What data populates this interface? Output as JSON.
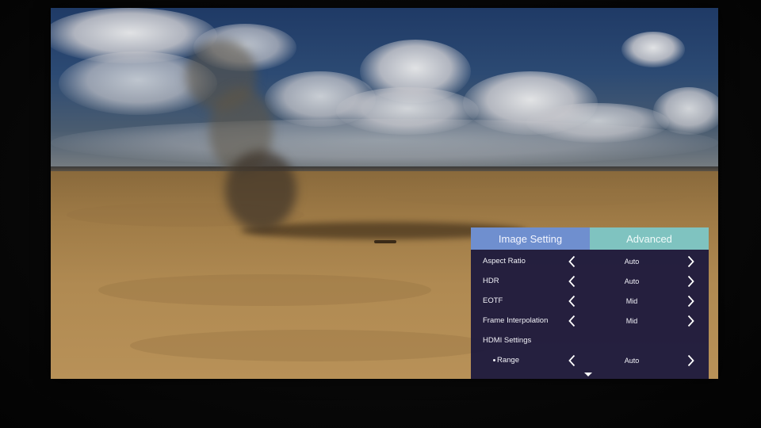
{
  "osd": {
    "tabs": [
      {
        "label": "Image Setting",
        "active": true
      },
      {
        "label": "Advanced",
        "active": false
      }
    ],
    "rows": [
      {
        "label": "Aspect Ratio",
        "value": "Auto"
      },
      {
        "label": "HDR",
        "value": "Auto"
      },
      {
        "label": "EOTF",
        "value": "Mid"
      },
      {
        "label": "Frame Interpolation",
        "value": "Mid"
      },
      {
        "label": "HDMI Settings"
      },
      {
        "label": "Range",
        "value": "Auto"
      }
    ],
    "colors": {
      "menu_background": "#201c3e",
      "tab_active": "#6f8fcf",
      "tab_inactive": "#7fc3c0",
      "text": "#f2f2f8"
    },
    "icons": {
      "decrement": "chevron-left-icon",
      "increment": "chevron-right-icon",
      "more": "caret-down-icon"
    }
  }
}
